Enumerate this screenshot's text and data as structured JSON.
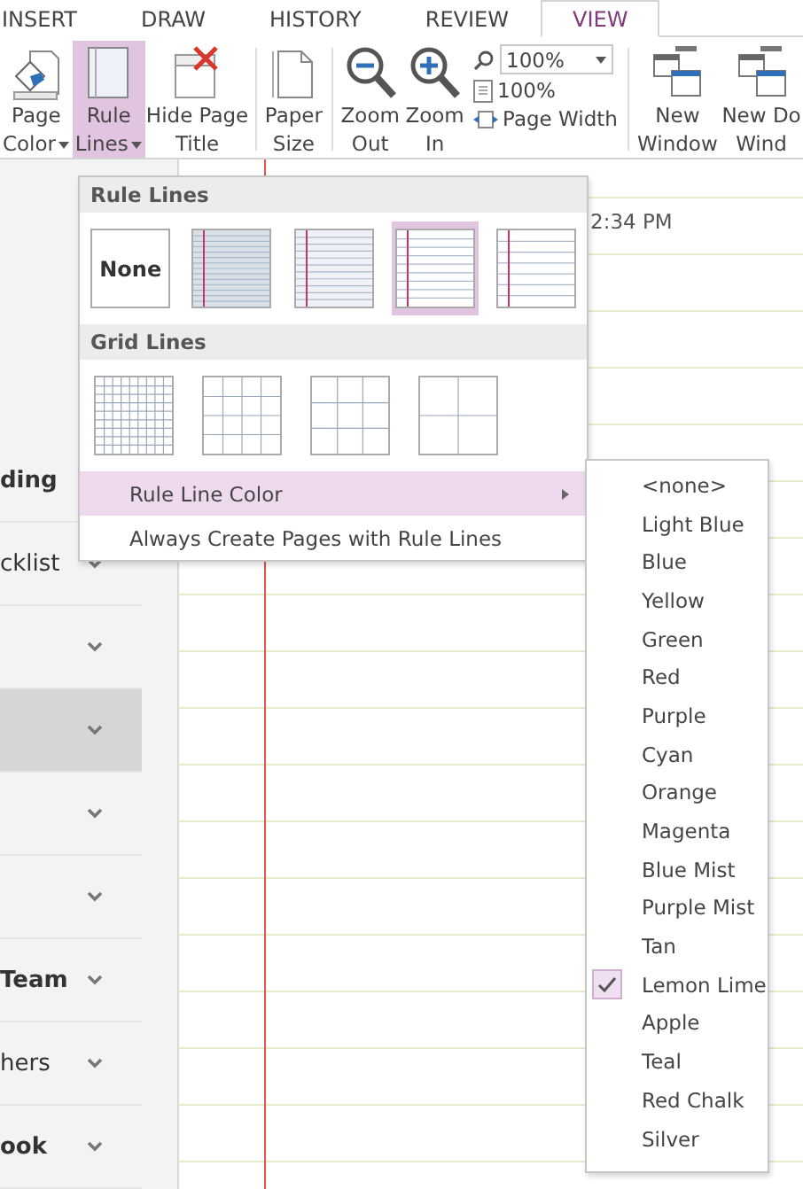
{
  "tabs": [
    {
      "label": "INSERT",
      "selected": false
    },
    {
      "label": "DRAW",
      "selected": false
    },
    {
      "label": "HISTORY",
      "selected": false
    },
    {
      "label": "REVIEW",
      "selected": false
    },
    {
      "label": "VIEW",
      "selected": true
    }
  ],
  "ribbon": [
    {
      "kind": "button",
      "label": "Page Color",
      "caret": true,
      "selected": false
    },
    {
      "kind": "button",
      "label": "Rule Lines",
      "caret": true,
      "selected": true
    },
    {
      "kind": "button",
      "label": "Hide Page Title",
      "caret": false,
      "selected": false
    },
    {
      "kind": "separator"
    },
    {
      "kind": "button",
      "label": "Paper Size",
      "caret": false,
      "selected": false
    },
    {
      "kind": "separator"
    },
    {
      "kind": "button",
      "label": "Zoom Out",
      "caret": false,
      "selected": false
    },
    {
      "kind": "button",
      "label": "Zoom In",
      "caret": false,
      "selected": false
    },
    {
      "kind": "zoom",
      "value": "100%",
      "actual": "100%",
      "page_width": "Page Width"
    },
    {
      "kind": "separator"
    },
    {
      "kind": "button",
      "label": "New Window",
      "caret": false,
      "selected": false
    },
    {
      "kind": "button",
      "label": "New Do Wind",
      "caret": false,
      "selected": false
    }
  ],
  "sidebar": {
    "items": [
      {
        "label": "ding",
        "bold": true,
        "selected": false
      },
      {
        "label": "cklist",
        "bold": false,
        "selected": false
      },
      {
        "selected": false
      },
      {
        "selected": true
      },
      {
        "selected": false
      },
      {
        "selected": false
      },
      {
        "label": "Team",
        "bold": true,
        "selected": false
      },
      {
        "label": "hers",
        "bold": false,
        "selected": false
      },
      {
        "label": "ook",
        "bold": true,
        "selected": false
      }
    ]
  },
  "page": {
    "time": "2:34 PM"
  },
  "menu": {
    "sections": [
      {
        "title": "Rule Lines",
        "options": [
          {
            "kind": "none",
            "label": "None",
            "selected": false
          },
          {
            "kind": "narrow",
            "selected": false
          },
          {
            "kind": "college",
            "selected": false
          },
          {
            "kind": "standard",
            "selected": true
          },
          {
            "kind": "wide",
            "selected": false
          }
        ]
      },
      {
        "title": "Grid Lines",
        "options": [
          {
            "kind": "grid-small",
            "selected": false
          },
          {
            "kind": "grid-medium",
            "selected": false
          },
          {
            "kind": "grid-large",
            "selected": false
          },
          {
            "kind": "grid-xlarge",
            "selected": false
          }
        ]
      }
    ],
    "items": [
      {
        "label": "Rule Line Color",
        "submenu": true,
        "highlighted": true
      },
      {
        "label": "Always Create Pages with Rule Lines",
        "submenu": false,
        "highlighted": false
      }
    ]
  },
  "color_menu": [
    {
      "label": "<none>",
      "checked": false
    },
    {
      "label": "Light Blue",
      "checked": false
    },
    {
      "label": "Blue",
      "checked": false
    },
    {
      "label": "Yellow",
      "checked": false
    },
    {
      "label": "Green",
      "checked": false
    },
    {
      "label": "Red",
      "checked": false
    },
    {
      "label": "Purple",
      "checked": false
    },
    {
      "label": "Cyan",
      "checked": false
    },
    {
      "label": "Orange",
      "checked": false
    },
    {
      "label": "Magenta",
      "checked": false
    },
    {
      "label": "Blue Mist",
      "checked": false
    },
    {
      "label": "Purple Mist",
      "checked": false
    },
    {
      "label": "Tan",
      "checked": false
    },
    {
      "label": "Lemon Lime",
      "checked": true
    },
    {
      "label": "Apple",
      "checked": false
    },
    {
      "label": "Teal",
      "checked": false
    },
    {
      "label": "Red Chalk",
      "checked": false
    },
    {
      "label": "Silver",
      "checked": false
    }
  ]
}
